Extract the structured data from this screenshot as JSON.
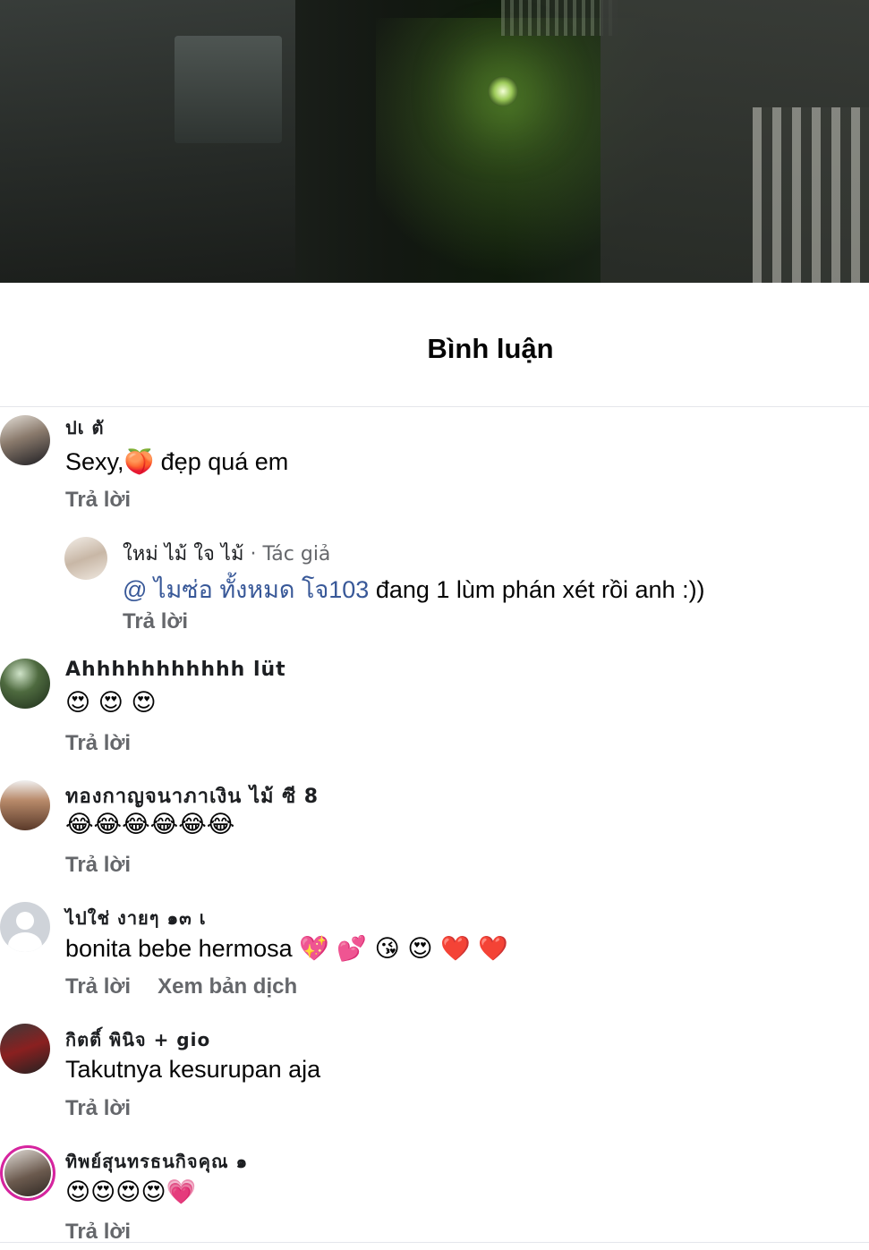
{
  "header": {
    "title": "Bình luận"
  },
  "comments": [
    {
      "author": "ปเ ตั",
      "text_before": "Sexy,",
      "emoji": "🍑",
      "text_after": " đẹp quá em",
      "action_reply": "Trả lời",
      "replies": [
        {
          "author": "ใหม่ ไม้ ใจ ไม้",
          "author_badge": "· Tác giả",
          "mention": "@ ไมซ่อ ทั้งหมด โจ103",
          "text": " đang  1 lùm phán xét rồi anh :))",
          "action_reply": "Trả lời"
        }
      ]
    },
    {
      "author": "Ahhhhhhhhhhh lüt",
      "emoji": "😍 😍 😍",
      "action_reply": "Trả lời"
    },
    {
      "author": "ทองกาญจนาภาเงิน ไม้ ซี 8",
      "emoji": "😂😂😂😂😂😂",
      "action_reply": "Trả lời"
    },
    {
      "author": "ไปใช่ งายๆ ๑๓ เ",
      "text": "bonita bebe hermosa ",
      "emoji": "💖 💕 😘 😍 ❤️ ❤️",
      "action_reply": "Trả lời",
      "action_translate": "Xem bản dịch"
    },
    {
      "author": "กิตติ์ พินิจ + gio",
      "text": "Takutnya kesurupan aja",
      "action_reply": "Trả lời"
    },
    {
      "author": "ทิพย์สุนทรธนกิจคุณ ๑",
      "emoji": "😍😍😍😍💗",
      "action_reply": "Trả lời"
    }
  ]
}
